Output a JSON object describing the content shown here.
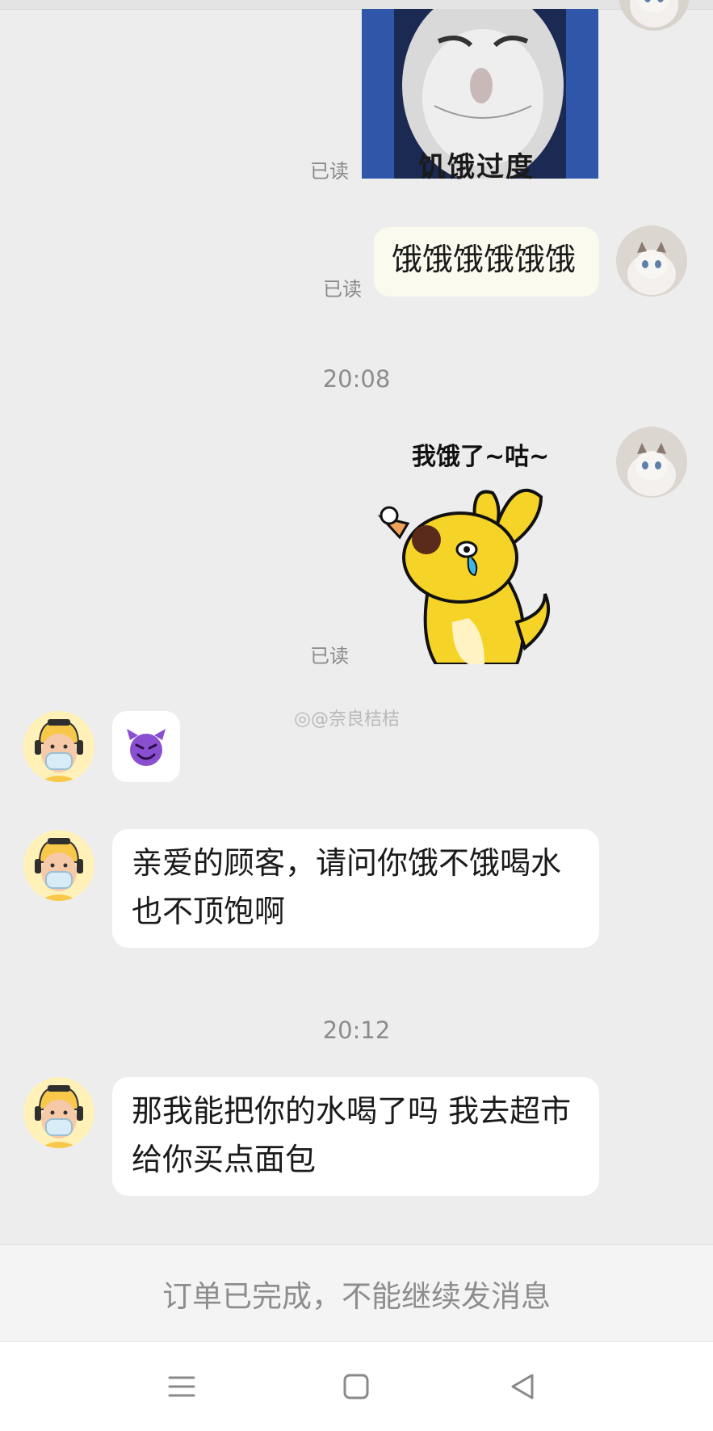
{
  "messages": {
    "m1_read": "已读",
    "m1_image_caption": "饥饿过度",
    "m2_text": "饿饿饿饿饿饿",
    "m2_read": "已读",
    "time1": "20:08",
    "m3_sticker_caption": "我饿了~咕~",
    "m3_read": "已读",
    "m5_text": "亲爱的顾客，请问你饿不饿喝水也不顶饱啊",
    "time2": "20:12",
    "m6_text": "那我能把你的水喝了吗 我去超市给你买点面包"
  },
  "watermark": "@奈良桔桔",
  "footer": {
    "closed_notice": "订单已完成，不能继续发消息"
  },
  "icons": {
    "emoji": "smiling-devil-emoji",
    "nav_menu": "menu-icon",
    "nav_home": "home-square-icon",
    "nav_back": "back-triangle-icon"
  },
  "colors": {
    "background": "#ededed",
    "my_bubble": "#fbfaee",
    "their_bubble": "#ffffff",
    "sticker_yellow": "#f5d327",
    "devil_purple": "#8a4fd0"
  }
}
